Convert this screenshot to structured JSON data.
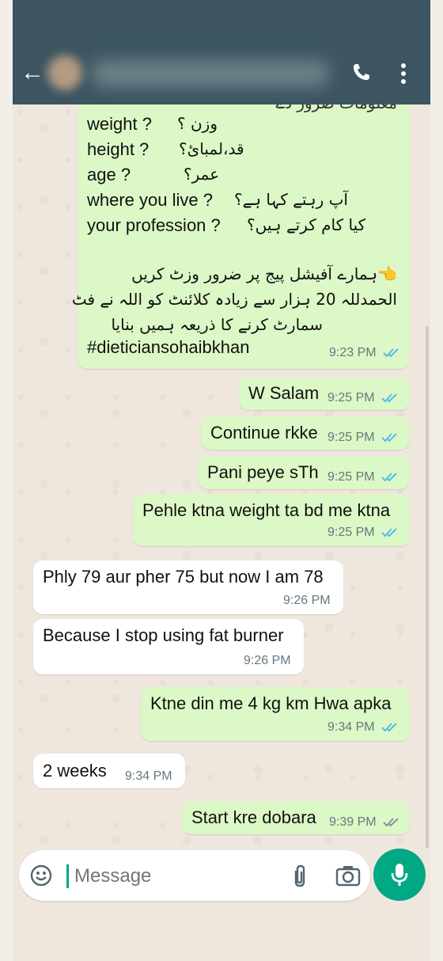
{
  "header": {
    "back_label": "←",
    "contact_name": "",
    "colors": {
      "header_bg": "#3c5560",
      "outgoing": "#dcf8c6",
      "incoming": "#ffffff",
      "accent": "#00a884",
      "read_ticks": "#53bdeb"
    }
  },
  "messages": [
    {
      "id": "m1",
      "direction": "outgoing",
      "partial_top_line": "معلومات ضرور دے",
      "form_lines": [
        {
          "en": "weight ?",
          "ur": "وزن ؟"
        },
        {
          "en": "height ?",
          "ur": "قد،لمبائ؟"
        },
        {
          "en": "age  ?",
          "ur": "عمر؟"
        },
        {
          "en": "where you live ?",
          "ur": "آپ رہتے کہا ہے؟"
        },
        {
          "en": "your profession ?",
          "ur": "کیا کام کرتے ہیں؟"
        }
      ],
      "urdu_paragraph": [
        "👈ہمارے آفیشل پیج پر ضرور وزٹ کریں",
        "الحمدللہ 20 ہزار سے زیادہ کلائنٹ کو اللہ نے فٹ",
        "سمارٹ کرنے کا ذریعہ ہمیں بنایا"
      ],
      "hashtag": "#dieticiansohaibkhan",
      "time": "9:23 PM",
      "ticks": "read"
    },
    {
      "id": "m2",
      "direction": "outgoing",
      "text": "W Salam",
      "time": "9:25 PM",
      "ticks": "read"
    },
    {
      "id": "m3",
      "direction": "outgoing",
      "text": "Continue rkke",
      "time": "9:25 PM",
      "ticks": "read"
    },
    {
      "id": "m4",
      "direction": "outgoing",
      "text": "Pani peye sTh",
      "time": "9:25 PM",
      "ticks": "read"
    },
    {
      "id": "m5",
      "direction": "outgoing",
      "text": "Pehle ktna weight ta bd me ktna",
      "time": "9:25 PM",
      "ticks": "read"
    },
    {
      "id": "m6",
      "direction": "incoming",
      "text": "Phly 79 aur pher 75 but now I am 78",
      "time": "9:26 PM"
    },
    {
      "id": "m7",
      "direction": "incoming",
      "text": "Because I stop using fat burner",
      "time": "9:26 PM"
    },
    {
      "id": "m8",
      "direction": "outgoing",
      "text": "Ktne din me 4 kg km Hwa apka",
      "time": "9:34 PM",
      "ticks": "read"
    },
    {
      "id": "m9",
      "direction": "incoming",
      "text": "2 weeks",
      "time": "9:34 PM"
    },
    {
      "id": "m10",
      "direction": "outgoing",
      "text": "Start kre dobara",
      "time": "9:39 PM",
      "ticks": "delivered"
    }
  ],
  "composer": {
    "placeholder": "Message",
    "icons": {
      "emoji": "emoji-icon",
      "attach": "paperclip-icon",
      "camera": "camera-icon",
      "send": "mic-icon"
    }
  }
}
